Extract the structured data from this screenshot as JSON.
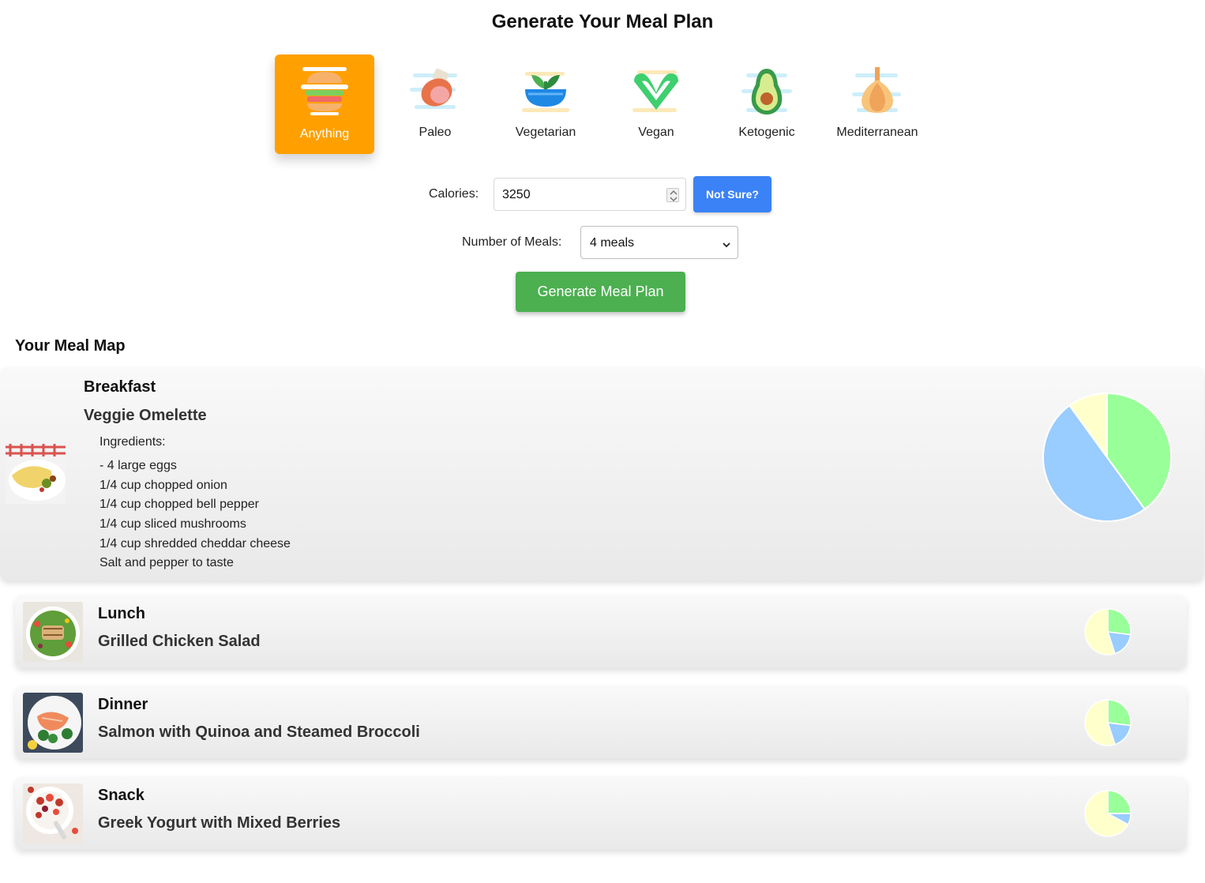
{
  "page": {
    "title": "Generate Your Meal Plan"
  },
  "diets": [
    {
      "label": "Anything",
      "icon": "burger-icon",
      "active": true
    },
    {
      "label": "Paleo",
      "icon": "meat-icon",
      "active": false
    },
    {
      "label": "Vegetarian",
      "icon": "plant-bowl-icon",
      "active": false
    },
    {
      "label": "Vegan",
      "icon": "vegan-v-icon",
      "active": false
    },
    {
      "label": "Ketogenic",
      "icon": "avocado-icon",
      "active": false
    },
    {
      "label": "Mediterranean",
      "icon": "garlic-icon",
      "active": false
    }
  ],
  "form": {
    "calories_label": "Calories:",
    "calories_value": "3250",
    "not_sure_label": "Not Sure?",
    "meals_label": "Number of Meals:",
    "meals_value": "4 meals",
    "generate_label": "Generate Meal Plan"
  },
  "meal_map": {
    "title": "Your Meal Map",
    "meals": [
      {
        "type": "Breakfast",
        "name": "Veggie Omelette",
        "expanded": true,
        "ingredients_label": "Ingredients:",
        "ingredients": [
          "- 4 large eggs",
          "1/4 cup chopped onion",
          "1/4 cup chopped bell pepper",
          "1/4 cup sliced mushrooms",
          "1/4 cup shredded cheddar cheese",
          "Salt and pepper to taste"
        ],
        "macros": [
          0.4,
          0.5,
          0.1
        ]
      },
      {
        "type": "Lunch",
        "name": "Grilled Chicken Salad",
        "expanded": false,
        "macros": [
          0.27,
          0.18,
          0.55
        ]
      },
      {
        "type": "Dinner",
        "name": "Salmon with Quinoa and Steamed Broccoli",
        "expanded": false,
        "macros": [
          0.27,
          0.18,
          0.55
        ]
      },
      {
        "type": "Snack",
        "name": "Greek Yogurt with Mixed Berries",
        "expanded": false,
        "macros": [
          0.25,
          0.08,
          0.67
        ]
      }
    ]
  },
  "colors": {
    "active_diet": "#ffa000",
    "not_sure_button": "#3b82f6",
    "generate_button": "#4caf50",
    "pie_green": "#99ff99",
    "pie_blue": "#99ccff",
    "pie_yellow": "#ffffcc"
  }
}
